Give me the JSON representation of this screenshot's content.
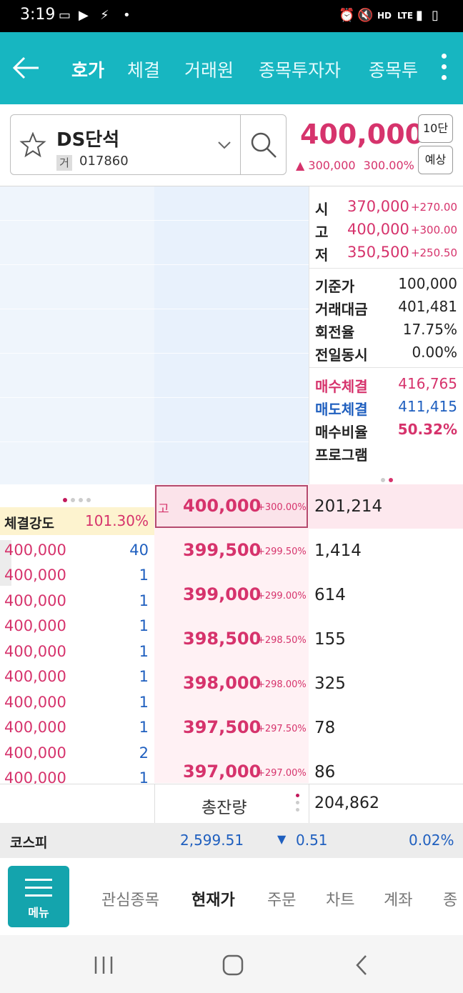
{
  "status_bar": {
    "time": "3:19",
    "network": "LTE",
    "voice": "HD"
  },
  "header": {
    "tabs": [
      "호가",
      "체결",
      "거래원",
      "종목투자자",
      "종목투"
    ],
    "active_tab": "호가"
  },
  "stock": {
    "name": "DS단석",
    "exchange_badge": "거",
    "code": "017860",
    "price": "400,000",
    "change": "300,000",
    "change_pct": "300.00%",
    "btn_levels": "10단",
    "btn_forecast": "예상"
  },
  "summary": {
    "open": {
      "label": "시",
      "value": "370,000",
      "pct": "+270.00"
    },
    "high": {
      "label": "고",
      "value": "400,000",
      "pct": "+300.00"
    },
    "low": {
      "label": "저",
      "value": "350,500",
      "pct": "+250.50"
    },
    "rows": [
      {
        "label": "기준가",
        "value": "100,000"
      },
      {
        "label": "거래대금",
        "value": "401,481"
      },
      {
        "label": "회전율",
        "value": "17.75%"
      },
      {
        "label": "전일동시",
        "value": "0.00%"
      }
    ],
    "buy_exec": {
      "label": "매수체결",
      "value": "416,765"
    },
    "sell_exec": {
      "label": "매도체결",
      "value": "411,415"
    },
    "buy_ratio": {
      "label": "매수비율",
      "value": "50.32%"
    },
    "program": {
      "label": "프로그램"
    }
  },
  "strength": {
    "label": "체결강도",
    "value": "101.30%"
  },
  "recent_trades": [
    {
      "price": "400,000",
      "qty": "40"
    },
    {
      "price": "400,000",
      "qty": "1"
    },
    {
      "price": "400,000",
      "qty": "1"
    },
    {
      "price": "400,000",
      "qty": "1"
    },
    {
      "price": "400,000",
      "qty": "1"
    },
    {
      "price": "400,000",
      "qty": "1"
    },
    {
      "price": "400,000",
      "qty": "1"
    },
    {
      "price": "400,000",
      "qty": "1"
    },
    {
      "price": "400,000",
      "qty": "2"
    },
    {
      "price": "400,000",
      "qty": "1"
    }
  ],
  "bids": [
    {
      "tag": "고",
      "price": "400,000",
      "pct": "+300.00%",
      "qty": "201,214"
    },
    {
      "tag": "",
      "price": "399,500",
      "pct": "+299.50%",
      "qty": "1,414"
    },
    {
      "tag": "",
      "price": "399,000",
      "pct": "+299.00%",
      "qty": "614"
    },
    {
      "tag": "",
      "price": "398,500",
      "pct": "+298.50%",
      "qty": "155"
    },
    {
      "tag": "",
      "price": "398,000",
      "pct": "+298.00%",
      "qty": "325"
    },
    {
      "tag": "",
      "price": "397,500",
      "pct": "+297.50%",
      "qty": "78"
    },
    {
      "tag": "",
      "price": "397,000",
      "pct": "+297.00%",
      "qty": "86"
    }
  ],
  "total": {
    "label": "총잔량",
    "value": "204,862"
  },
  "kospi": {
    "label": "코스피",
    "value": "2,599.51",
    "change": "0.51",
    "pct": "0.02%"
  },
  "bottom_nav": {
    "menu_label": "메뉴",
    "items": [
      "관심종목",
      "현재가",
      "주문",
      "차트",
      "계좌",
      "종"
    ],
    "active": "현재가"
  },
  "colors": {
    "accent": "#17b6c1",
    "up": "#d6336c",
    "down": "#1f5fbf"
  }
}
